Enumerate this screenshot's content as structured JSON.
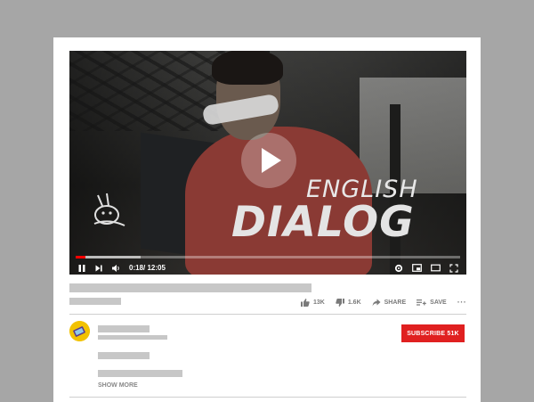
{
  "video": {
    "title_overlay_line1": "ENGLISH",
    "title_overlay_line2": "DIALOG",
    "time_display": "0:18/ 12:05",
    "progress_played": 0.025,
    "progress_buffered": 0.17
  },
  "actions": {
    "likes": "13K",
    "dislikes": "1.6K",
    "share_label": "SHARE",
    "save_label": "SAVE",
    "more_label": "···"
  },
  "channel": {
    "subscribe_label": "SUBSCRIBE 51K"
  },
  "description": {
    "show_more_label": "SHOW MORE"
  },
  "colors": {
    "background": "#a6a6a6",
    "accent_red": "#e02020",
    "progress_red": "#ff0000",
    "placeholder_gray": "#c7c7c7",
    "avatar_yellow": "#f2c200"
  },
  "icons": [
    "pause-icon",
    "next-icon",
    "volume-icon",
    "settings-icon",
    "miniplayer-icon",
    "theater-icon",
    "fullscreen-icon",
    "play-icon",
    "thumbs-up-icon",
    "thumbs-down-icon",
    "share-icon",
    "save-playlist-icon",
    "more-icon"
  ]
}
